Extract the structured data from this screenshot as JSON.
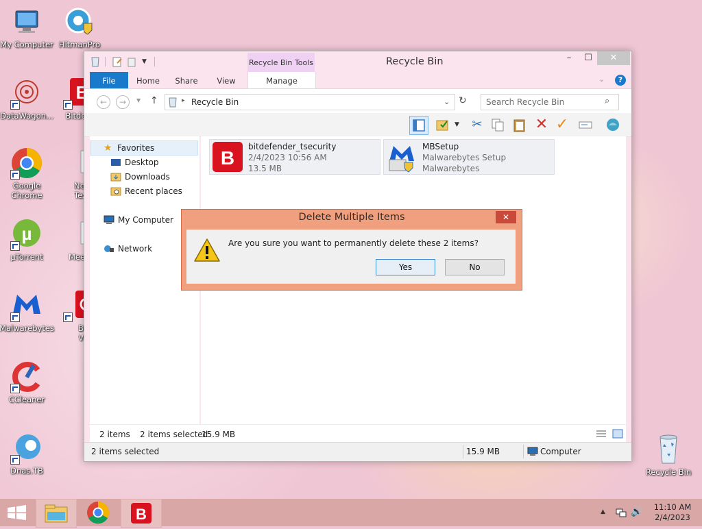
{
  "desktop": {
    "icons": [
      {
        "label": "My Computer"
      },
      {
        "label": "HitmanPro"
      },
      {
        "label": "DataWagon..."
      },
      {
        "label": "Bitdefe"
      },
      {
        "label": "Google Chrome"
      },
      {
        "label": "New F Text D"
      },
      {
        "label": "µTorrent"
      },
      {
        "label": "Mee"
      },
      {
        "label": "Malwarebytes"
      },
      {
        "label": "Bitdefe VPI"
      },
      {
        "label": "CCleaner"
      },
      {
        "label": "Dnas.TB"
      },
      {
        "label": "Recycle Bin"
      }
    ]
  },
  "window": {
    "title": "Recycle Bin",
    "contextual_tab": "Recycle Bin Tools",
    "controls": {
      "minimize": "–",
      "maximize": "☐",
      "close": "✕"
    },
    "tabs": {
      "file": "File",
      "home": "Home",
      "share": "Share",
      "view": "View",
      "manage": "Manage"
    },
    "address": {
      "path": "Recycle Bin"
    },
    "search": {
      "placeholder": "Search Recycle Bin"
    },
    "nav": {
      "favorites": "Favorites",
      "desktop": "Desktop",
      "downloads": "Downloads",
      "recent": "Recent places",
      "computer": "My Computer",
      "network": "Network"
    },
    "files": [
      {
        "name": "bitdefender_tsecurity",
        "line2": "2/4/2023 10:56 AM",
        "line3": "13.5 MB"
      },
      {
        "name": "MBSetup",
        "line2": "Malwarebytes Setup",
        "line3": "Malwarebytes"
      }
    ],
    "info": {
      "count": "2 items",
      "selected": "2 items selected",
      "size": "15.9 MB"
    },
    "status": {
      "selected": "2 items selected",
      "size": "15.9 MB",
      "location": "Computer"
    }
  },
  "dialog": {
    "title": "Delete Multiple Items",
    "close": "✕",
    "message": "Are you sure you want to permanently delete these 2 items?",
    "yes": "Yes",
    "no": "No"
  },
  "taskbar": {
    "time": "11:10 AM",
    "date": "2/4/2023"
  },
  "colors": {
    "accent": "#1979ca",
    "dialog_frame": "#f0a07f",
    "taskbar": "#d8a7a6",
    "bitdefender_red": "#d8121f"
  }
}
